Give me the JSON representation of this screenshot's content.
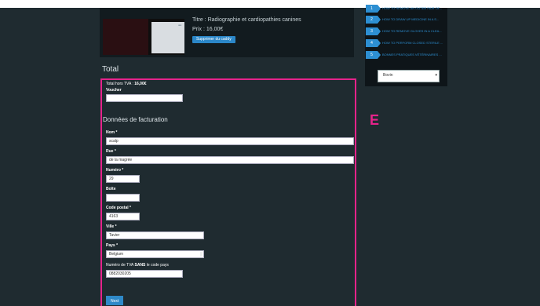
{
  "product": {
    "title": "Titre : Radiographie et cardiopathies canines",
    "price": "Prix : 16,00€",
    "remove_label": "Supprimer du caddy"
  },
  "sidebar": {
    "items": [
      {
        "num": "1",
        "label": "HOW TO REMOVE AN OUTER PAIR OF..."
      },
      {
        "num": "2",
        "label": "HOW TO DRAW UP MEDICINE IN A S..."
      },
      {
        "num": "3",
        "label": "HOW TO REMOVE GLOVES IN A CLEA..."
      },
      {
        "num": "4",
        "label": "HOW TO PERFORM CLOSED STERILE ..."
      },
      {
        "num": "5",
        "label": "BONNES PRATIQUES VÉTÉRINAIRES ..."
      }
    ],
    "select_value": "Bovin"
  },
  "total": {
    "heading": "Total",
    "total_label": "Total hors TVA : ",
    "total_value": "16,00€",
    "voucher_label": "Voucher",
    "voucher_value": ""
  },
  "billing": {
    "title": "Données de facturation",
    "nom_label": "Nom *",
    "nom_value": "scalp",
    "rue_label": "Rue *",
    "rue_value": "de la magrée",
    "numero_label": "Numéro *",
    "numero_value": "29",
    "boite_label": "Boîte",
    "boite_value": "",
    "cp_label": "Code postal *",
    "cp_value": "4163",
    "ville_label": "Ville *",
    "ville_value": "Tavier",
    "pays_label": "Pays *",
    "pays_value": "Belgium",
    "tva_label_pre": "Numéro de TVA ",
    "tva_label_bold": "SANS",
    "tva_label_post": " le code pays",
    "tva_value": "0882030205",
    "next_label": "Next"
  },
  "annotation": {
    "letter": "E"
  },
  "colors": {
    "highlight": "#e6238b",
    "accent": "#2d8fd2",
    "background": "#1f2b30"
  }
}
